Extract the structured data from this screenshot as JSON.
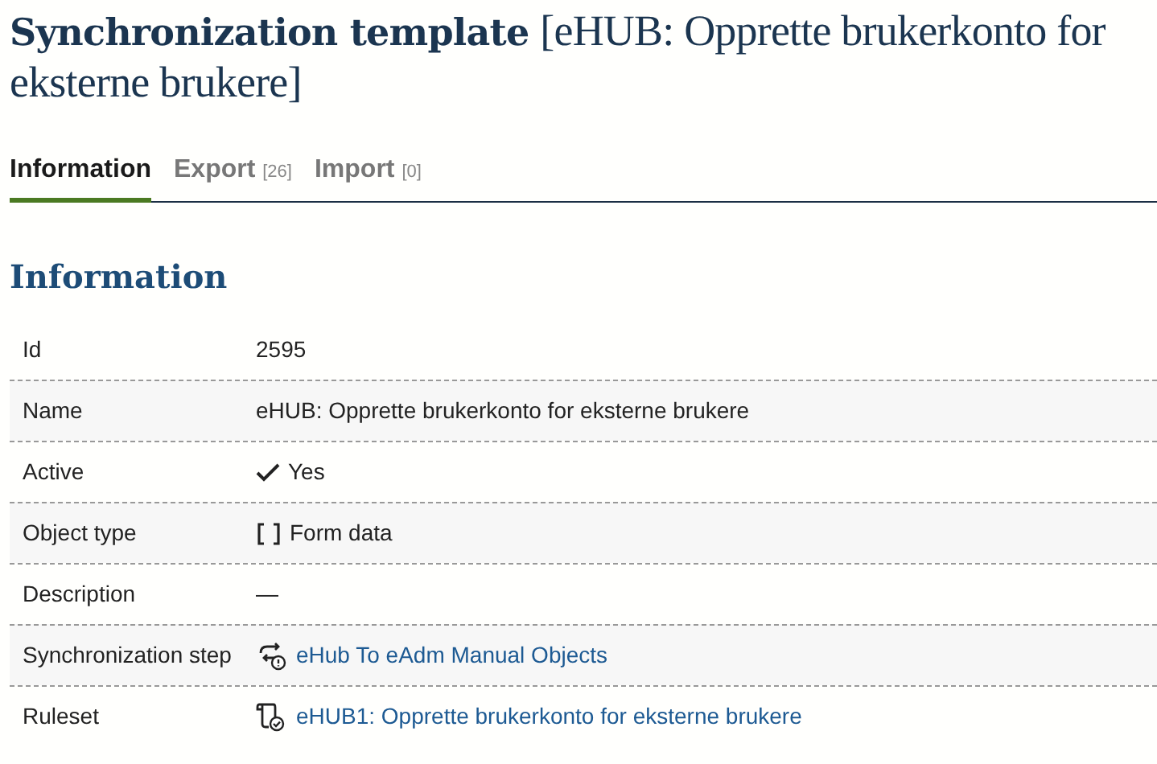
{
  "title": {
    "main": "Synchronization template",
    "subtitle": "[eHUB: Opprette brukerkonto for eksterne brukere]"
  },
  "tabs": [
    {
      "label": "Information",
      "selected": true
    },
    {
      "label": "Export",
      "count": "[26]",
      "selected": false
    },
    {
      "label": "Import",
      "count": "[0]",
      "selected": false
    }
  ],
  "section_heading": "Information",
  "fields": [
    {
      "label": "Id",
      "kind": "text",
      "value": "2595"
    },
    {
      "label": "Name",
      "kind": "text",
      "value": "eHUB: Opprette brukerkonto for eksterne brukere"
    },
    {
      "label": "Active",
      "kind": "check",
      "value": "Yes"
    },
    {
      "label": "Object type",
      "kind": "type",
      "value": "Form data"
    },
    {
      "label": "Description",
      "kind": "text",
      "value": "—"
    },
    {
      "label": "Synchronization step",
      "kind": "step-link",
      "value": "eHub To eAdm Manual Objects"
    },
    {
      "label": "Ruleset",
      "kind": "ruleset-link",
      "value": "eHUB1: Opprette brukerkonto for eksterne brukere"
    }
  ]
}
